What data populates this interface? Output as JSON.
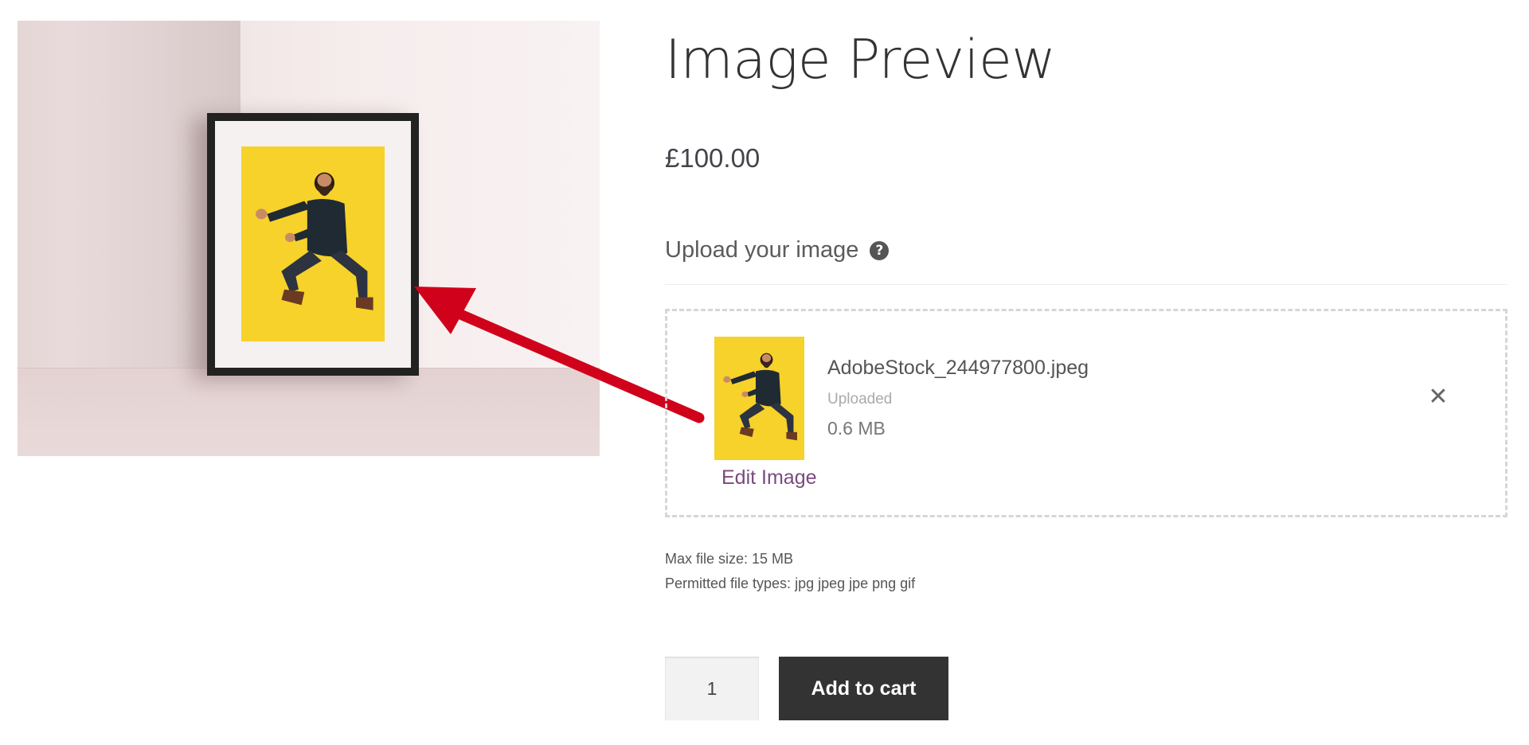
{
  "product": {
    "title": "Image Preview",
    "price": "£100.00"
  },
  "upload": {
    "label": "Upload your image",
    "help_icon": "question-circle-icon",
    "file": {
      "name": "AdobeStock_244977800.jpeg",
      "status": "Uploaded",
      "size": "0.6 MB",
      "edit_label": "Edit Image",
      "remove_icon": "close-icon"
    },
    "max_file_size": "Max file size: 15 MB",
    "permitted_types": "Permitted file types: jpg jpeg jpe png gif"
  },
  "cart": {
    "quantity": "1",
    "add_label": "Add to cart"
  },
  "colors": {
    "arrow": "#d0021b",
    "print_background": "#f6d22a",
    "button": "#333333",
    "link": "#7a4a7e"
  }
}
